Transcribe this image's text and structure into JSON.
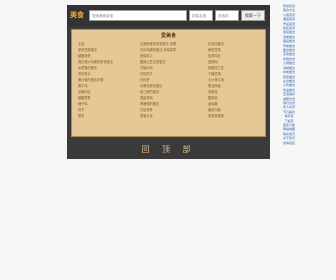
{
  "header": {
    "logo": "美食",
    "search_placeholder": "搜索美食菜谱",
    "select_1": "按菜名搜",
    "select_2": "请选择",
    "search_button": "搜索一下"
  },
  "card": {
    "title": "爱美食",
    "items": [
      "主菜",
      "清蒸鲈鱼的家常做法 步骤",
      "红烧肉做法",
      "家常豆腐做法",
      "可乐鸡翅的做法 简单易学",
      "麻婆豆腐",
      "糖醋排骨",
      "宫保鸡丁",
      "鱼香肉丝",
      "西红柿炒鸡蛋的家常做法",
      "酸辣土豆丝的做法",
      "回锅肉",
      "水煮鱼的做法 ",
      "青椒炒肉",
      "蒜蓉西兰花",
      "凉拌黄瓜",
      "红烧茄子",
      "干煸豆角",
      "蛋炒饭的做法步骤",
      "白灼虾",
      "小炒黄牛肉",
      "酱牛肉",
      "手撕包菜的做法",
      "葱油拌面",
      "京酱肉丝",
      "地三鲜的做法",
      "鸡蛋羹",
      "糖醋里脊",
      "香菇滑鸡",
      "酸菜鱼",
      "辣子鸡",
      "啤酒鸭的做法",
      "卤鸡腿",
      "饺子",
      "红烧排骨",
      "番茄牛腩",
      "更多",
      "菜谱大全",
      "家常菜推荐"
    ]
  },
  "footer": "回 顶 部",
  "sidebar": {
    "links": [
      "家常菜谱",
      "美食大全",
      "川菜菜谱",
      "湘菜菜谱",
      "粤菜菜谱",
      "鲁菜菜谱",
      "素菜做法",
      "汤类做法",
      "甜品做法",
      "早餐做法",
      "面食做法",
      "凉菜做法",
      "烘焙食谱",
      "火锅做法",
      "海鲜做法",
      "肉类做法",
      "蔬菜做法",
      "主食做法",
      "小吃做法",
      "饮品做法",
      "宝宝辅食",
      "减肥食谱",
      "孕妇食谱",
      "老人食谱",
      "节日美食",
      "快手菜",
      "下饭菜",
      "更多分类",
      "网站地图",
      "联系我们",
      "关于我们",
      "友情链接"
    ]
  }
}
